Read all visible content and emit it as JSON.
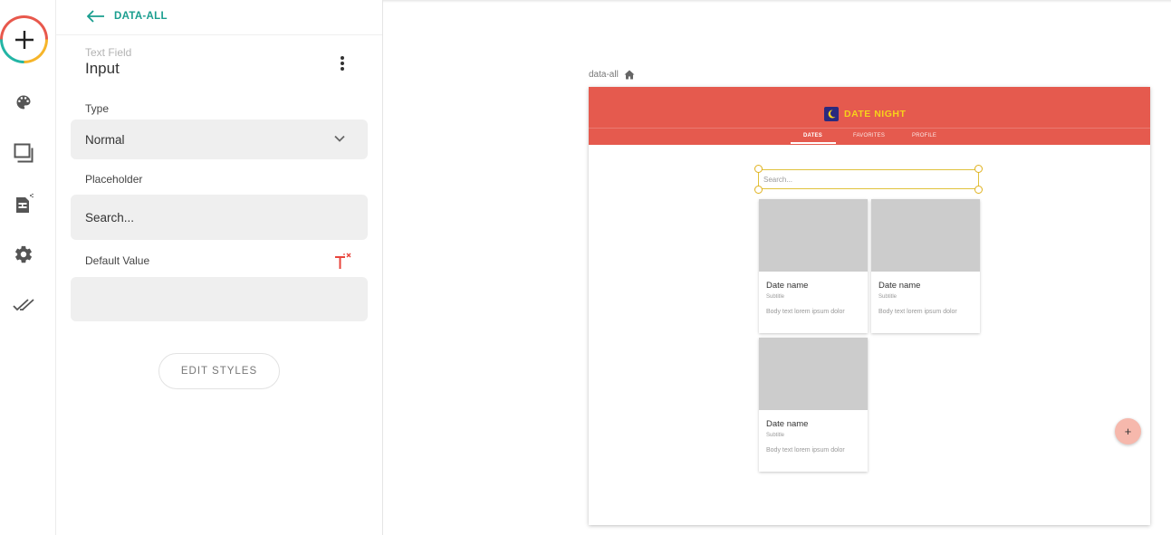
{
  "sidebar": {
    "icons": [
      "add-icon",
      "palette-icon",
      "screens-icon",
      "database-icon",
      "gear-icon",
      "double-check-icon"
    ]
  },
  "panel": {
    "back_label": "DATA-ALL",
    "component_type": "Text Field",
    "component_name": "Input",
    "type_label": "Type",
    "type_value": "Normal",
    "placeholder_label": "Placeholder",
    "placeholder_value": "Search...",
    "default_value_label": "Default Value",
    "default_value": "",
    "edit_styles_label": "EDIT STYLES"
  },
  "canvas": {
    "screen_name": "data-all",
    "app": {
      "title": "DATE NIGHT",
      "tabs": [
        {
          "label": "DATES",
          "active": true
        },
        {
          "label": "FAVORITES",
          "active": false
        },
        {
          "label": "PROFILE",
          "active": false
        }
      ],
      "search_placeholder": "Search...",
      "cards": [
        {
          "title": "Date name",
          "subtitle": "Subtitle",
          "body": "Body text lorem ipsum dolor"
        },
        {
          "title": "Date name",
          "subtitle": "Subtitle",
          "body": "Body text lorem ipsum dolor"
        },
        {
          "title": "Date name",
          "subtitle": "Subtitle",
          "body": "Body text lorem ipsum dolor"
        }
      ],
      "fab_label": "+",
      "colors": {
        "header": "#e55a4e",
        "logo_text": "#f6d21b",
        "selection": "#e0c23c",
        "fab": "#f6b8ac"
      }
    }
  },
  "colors": {
    "accent": "#1a9e8f",
    "danger_icon": "#e8453c"
  }
}
